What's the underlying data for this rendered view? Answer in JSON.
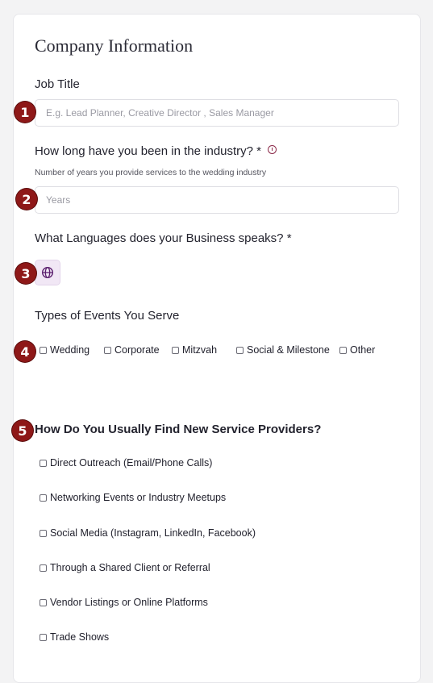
{
  "section_title": "Company Information",
  "job_title": {
    "label": "Job Title",
    "placeholder": "E.g. Lead Planner, Creative Director , Sales Manager",
    "value": ""
  },
  "industry": {
    "label": "How long have you been in the industry? *",
    "help": "Number of years you provide services to the wedding industry",
    "placeholder": "Years",
    "value": ""
  },
  "languages": {
    "label": "What Languages does your Business speaks? *",
    "icon": "globe-icon"
  },
  "events": {
    "label": "Types of Events You Serve",
    "options": [
      "Wedding",
      "Corporate",
      "Mitzvah",
      "Social & Milestone",
      "Other"
    ]
  },
  "providers": {
    "label": "How Do You Usually Find New Service Providers?",
    "options": [
      "Direct Outreach (Email/Phone Calls)",
      "Networking Events or Industry Meetups",
      "Social Media (Instagram, LinkedIn, Facebook)",
      "Through a Shared Client or Referral",
      "Vendor Listings or Online Platforms",
      "Trade Shows"
    ]
  },
  "badges": [
    "1",
    "2",
    "3",
    "4",
    "5"
  ],
  "colors": {
    "badge": "#8e1818",
    "accent": "#8c2b4a",
    "globe_bg": "#f1e7f5"
  }
}
